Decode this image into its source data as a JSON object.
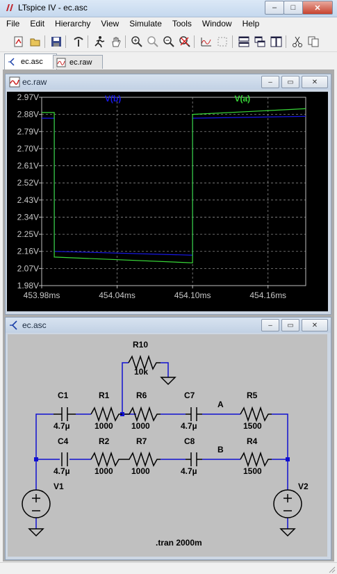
{
  "window": {
    "title": "LTspice IV - ec.asc",
    "minimize": "‒",
    "maximize": "□",
    "close": "✕"
  },
  "menu": [
    "File",
    "Edit",
    "Hierarchy",
    "View",
    "Simulate",
    "Tools",
    "Window",
    "Help"
  ],
  "toolbar_icons": [
    "new-schematic-icon",
    "open-icon",
    "save-icon",
    "control-panel-icon",
    "run-icon",
    "pan-hand-icon",
    "zoom-in-icon",
    "zoom-area-icon",
    "zoom-out-icon",
    "zoom-cancel-icon",
    "autorange-icon",
    "mark-unmark-icon",
    "tile-horizontal-icon",
    "cascade-icon",
    "tile-vertical-icon",
    "cut-icon",
    "copy-icon"
  ],
  "tabs": [
    {
      "label": "ec.asc",
      "active": true
    },
    {
      "label": "ec.raw",
      "active": false
    }
  ],
  "waveform_window": {
    "title": "ec.raw"
  },
  "schematic_window": {
    "title": "ec.asc"
  },
  "colors": {
    "trace_b": "#1818e8",
    "trace_a": "#38d838",
    "plot_bg": "#000000",
    "schematic_bg": "#c0c0c0",
    "wire": "#1010d0",
    "component": "#000000"
  },
  "chart_data": {
    "type": "line",
    "x_unit": "ms",
    "xlim": [
      453.98,
      454.19
    ],
    "x_ticks": [
      "453.98ms",
      "454.04ms",
      "454.10ms",
      "454.16ms"
    ],
    "ylim": [
      1.98,
      2.97
    ],
    "y_ticks": [
      "2.97V",
      "2.88V",
      "2.79V",
      "2.70V",
      "2.61V",
      "2.52V",
      "2.43V",
      "2.34V",
      "2.25V",
      "2.16V",
      "2.07V",
      "1.98V"
    ],
    "grid": true,
    "legend_position": "top",
    "series": [
      {
        "name": "V(b)",
        "color": "#1818e8",
        "x": [
          453.98,
          453.99,
          453.99,
          454.1,
          454.1,
          454.19
        ],
        "y": [
          2.86,
          2.86,
          2.16,
          2.14,
          2.86,
          2.87
        ]
      },
      {
        "name": "V(a)",
        "color": "#38d838",
        "x": [
          453.98,
          453.99,
          453.99,
          454.1,
          454.1,
          454.19
        ],
        "y": [
          2.89,
          2.89,
          2.13,
          2.1,
          2.88,
          2.91
        ]
      }
    ]
  },
  "schematic": {
    "components": {
      "R10": {
        "name": "R10",
        "value": "10k"
      },
      "C1": {
        "name": "C1",
        "value": "4.7µ"
      },
      "R1": {
        "name": "R1",
        "value": "1000"
      },
      "R6": {
        "name": "R6",
        "value": "1000"
      },
      "C7": {
        "name": "C7",
        "value": "4.7µ"
      },
      "R5": {
        "name": "R5",
        "value": "1500"
      },
      "C4": {
        "name": "C4",
        "value": "4.7µ"
      },
      "R2": {
        "name": "R2",
        "value": "1000"
      },
      "R7": {
        "name": "R7",
        "value": "1000"
      },
      "C8": {
        "name": "C8",
        "value": "4.7µ"
      },
      "R4": {
        "name": "R4",
        "value": "1500"
      },
      "V1": {
        "name": "V1"
      },
      "V2": {
        "name": "V2"
      }
    },
    "net_labels": {
      "A": "A",
      "B": "B"
    },
    "directive": ".tran 2000m"
  }
}
